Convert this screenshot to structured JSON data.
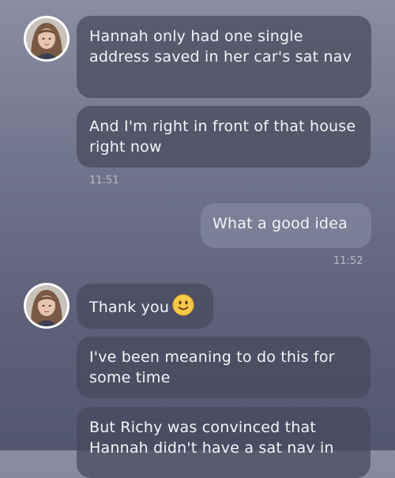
{
  "messages": [
    {
      "sender": "contact",
      "text": "Hannah only had one single address saved in her car's sat nav"
    },
    {
      "sender": "contact",
      "text": "And I'm right in front of that house right now"
    },
    {
      "sender": "contact",
      "time": "11:51"
    },
    {
      "sender": "me",
      "text": "What a good idea"
    },
    {
      "sender": "me",
      "time": "11:52"
    },
    {
      "sender": "contact",
      "text": "Thank you",
      "emoji": "slightly-smiling-face-icon"
    },
    {
      "sender": "contact",
      "text": "I've been meaning to do this for some time"
    },
    {
      "sender": "contact",
      "text": "But Richy was convinced that Hannah didn't have a sat nav in"
    }
  ],
  "colors": {
    "incoming_bubble": "#464a5c",
    "outgoing_bubble": "#82869e",
    "emoji_yellow": "#f7c948"
  }
}
